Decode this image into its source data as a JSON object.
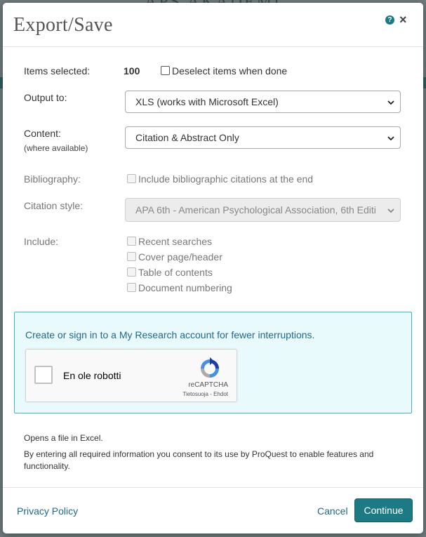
{
  "background": {
    "title": "APS AKADEMI"
  },
  "dialog": {
    "title": "Export/Save",
    "help_label": "?",
    "close_label": "×"
  },
  "form": {
    "items_selected_label": "Items selected:",
    "items_selected_value": "100",
    "deselect_label": "Deselect items when done",
    "output_label": "Output to:",
    "output_value": "XLS (works with Microsoft Excel)",
    "content_label": "Content:",
    "content_sublabel": "(where available)",
    "content_value": "Citation & Abstract Only",
    "bibliography_label": "Bibliography:",
    "bibliography_option": "Include bibliographic citations at the end",
    "citation_style_label": "Citation style:",
    "citation_style_value": "APA 6th - American Psychological Association, 6th Editi",
    "include_label": "Include:",
    "include_options": [
      "Recent searches",
      "Cover page/header",
      "Table of contents",
      "Document numbering"
    ]
  },
  "callout": {
    "link_text": "Create or sign in to a My Research account for fewer interruptions.",
    "captcha_label": "En ole robotti",
    "captcha_brand": "reCAPTCHA",
    "captcha_links": "Tietosuoja - Ehdot"
  },
  "notes": {
    "opens_file": "Opens a file in Excel.",
    "consent": "By entering all required information you consent to its use by ProQuest to enable features and functionality."
  },
  "footer": {
    "privacy_label": "Privacy Policy",
    "cancel_label": "Cancel",
    "continue_label": "Continue"
  },
  "colors": {
    "accent": "#1b7a84",
    "link": "#1c6a8a",
    "callout_bg": "#e9fafd",
    "callout_border": "#3fb3bf"
  }
}
